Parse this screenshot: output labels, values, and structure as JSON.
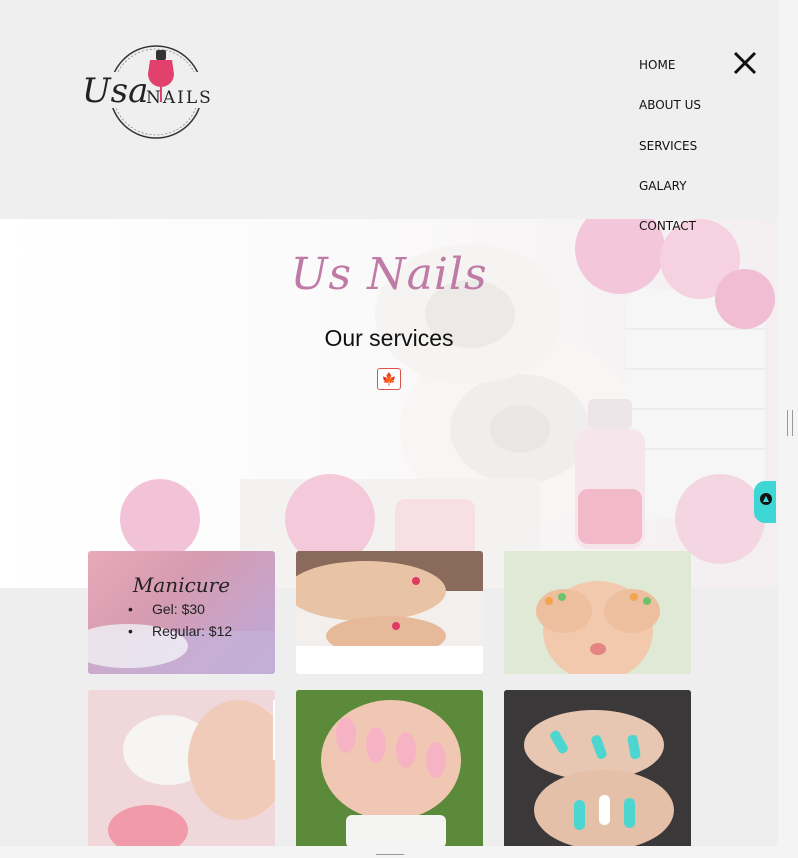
{
  "logo": {
    "text_part1": "Usa",
    "text_part2": "NAILS"
  },
  "nav": {
    "items": [
      {
        "label": "HOME"
      },
      {
        "label": "ABOUT US"
      },
      {
        "label": "SERVICES"
      },
      {
        "label": "GALARY"
      },
      {
        "label": "CONTACT"
      }
    ],
    "close_icon": "close-icon"
  },
  "hero": {
    "title": "Us Nails",
    "subtitle": "Our services",
    "flag_icon": "canada-flag-icon",
    "flag_glyph": "🍁"
  },
  "cards": [
    {
      "title": "Manicure",
      "items": [
        "Gel: $30",
        "Regular: $12"
      ]
    },
    {
      "title": "",
      "items": []
    },
    {
      "title": "",
      "items": []
    },
    {
      "title": "",
      "items": []
    },
    {
      "title": "",
      "items": []
    },
    {
      "title": "",
      "items": []
    }
  ],
  "colors": {
    "accent": "#c07aa6",
    "scroll_top": "#3fd6d6",
    "flag_red": "#d52b1e"
  }
}
